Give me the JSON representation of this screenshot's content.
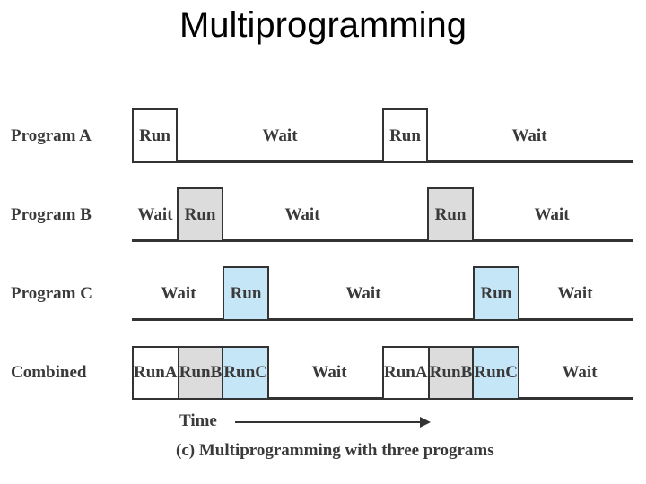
{
  "title": "Multiprogramming",
  "rows": [
    {
      "label": "Program A",
      "segments": [
        "Run",
        "Wait",
        "Run",
        "Wait"
      ]
    },
    {
      "label": "Program B",
      "segments": [
        "Wait",
        "Run",
        "Wait",
        "Run",
        "Wait"
      ]
    },
    {
      "label": "Program C",
      "segments": [
        "Wait",
        "Run",
        "Wait",
        "Run",
        "Wait"
      ]
    },
    {
      "label": "Combined",
      "segments": [
        "Run A",
        "Run B",
        "Run C",
        "Wait",
        "Run A",
        "Run B",
        "Run C",
        "Wait"
      ]
    }
  ],
  "combined": {
    "group1": [
      {
        "run": "Run",
        "prog": "A"
      },
      {
        "run": "Run",
        "prog": "B"
      },
      {
        "run": "Run",
        "prog": "C"
      }
    ],
    "wait1": "Wait",
    "group2": [
      {
        "run": "Run",
        "prog": "A"
      },
      {
        "run": "Run",
        "prog": "B"
      },
      {
        "run": "Run",
        "prog": "C"
      }
    ],
    "wait2": "Wait"
  },
  "colors": {
    "program_a": "#ffffff",
    "program_b": "#dcdcdc",
    "program_c": "#c5e6f7"
  },
  "axis_label": "Time",
  "caption": "(c) Multiprogramming with three programs"
}
